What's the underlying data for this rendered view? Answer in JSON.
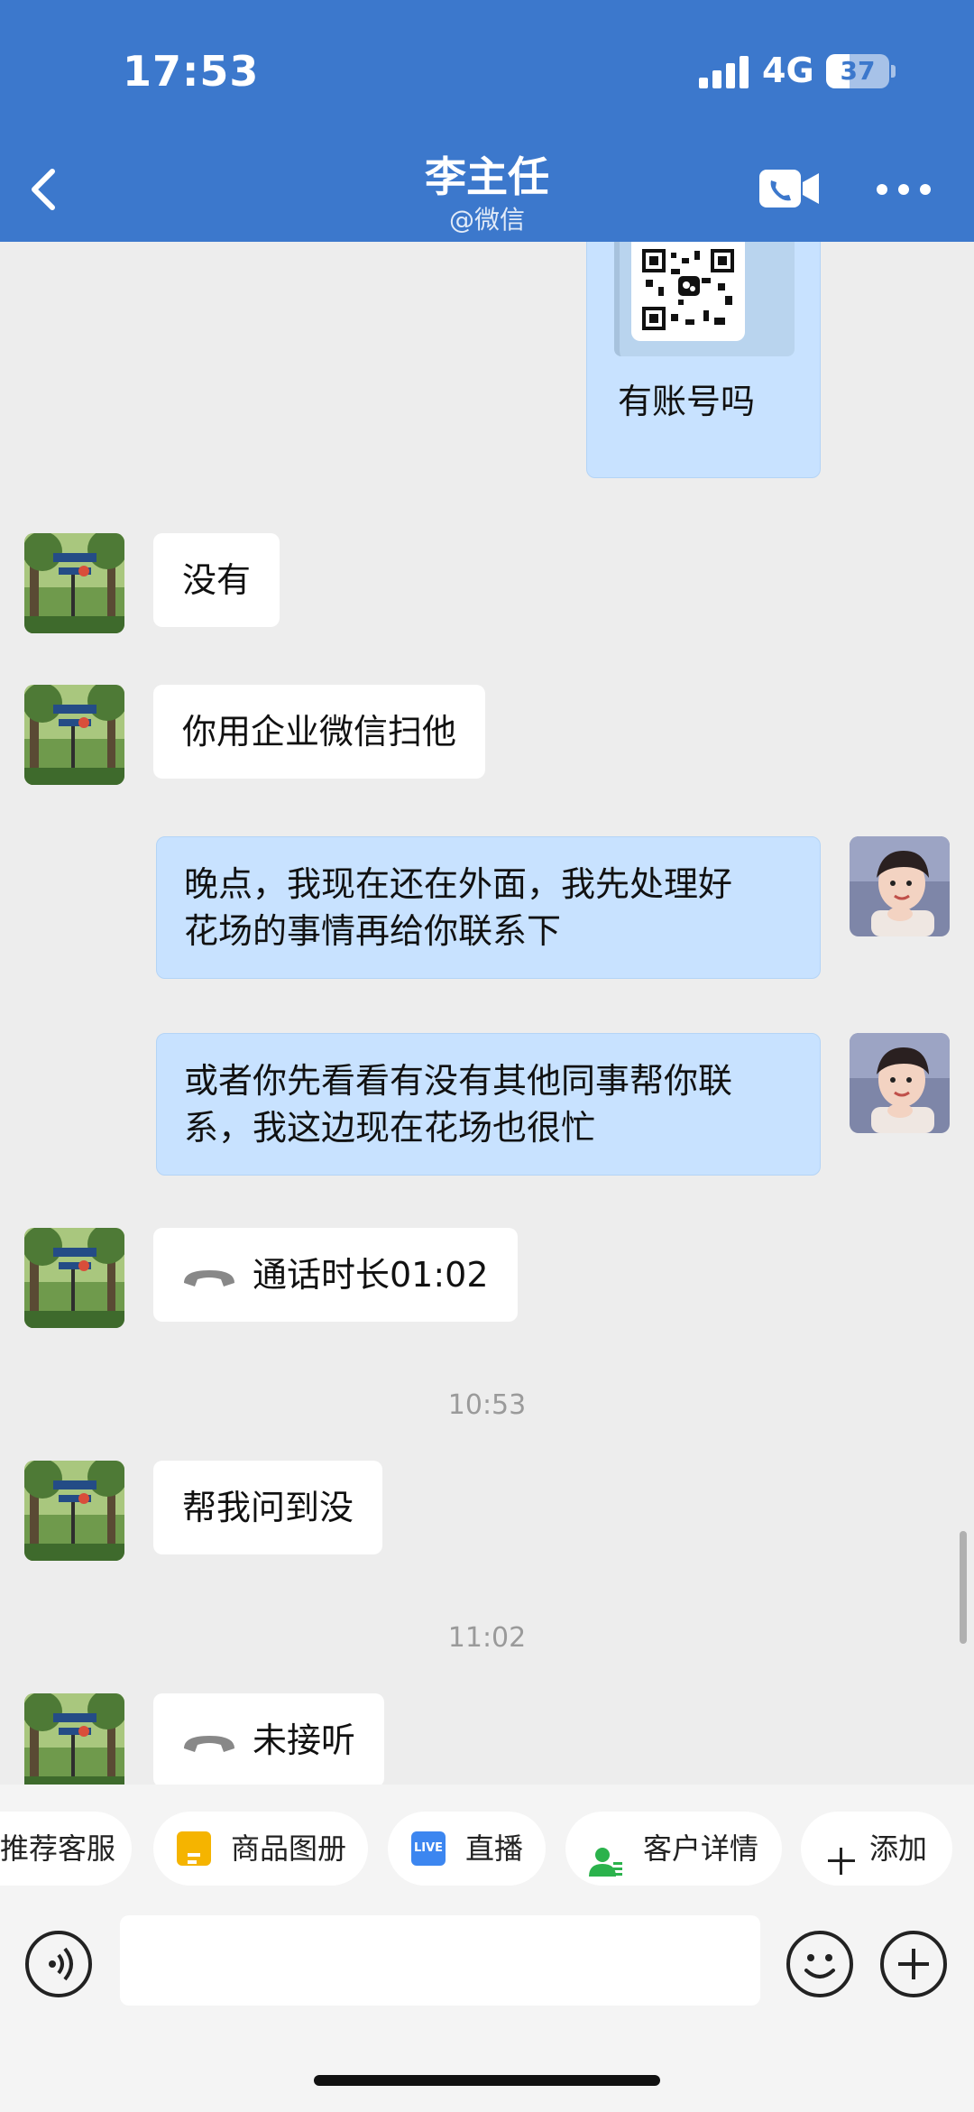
{
  "status_bar": {
    "time": "17:53",
    "network": "4G",
    "battery": "37",
    "battery_level": 0.37
  },
  "header": {
    "title": "李主任",
    "subtitle": "@微信"
  },
  "messages": {
    "qr_caption": "有账号吗",
    "m1": "没有",
    "m2": "你用企业微信扫他",
    "m3_line1": "晚点，我现在还在外面，我先处理好",
    "m3_line2": "花场的事情再给你联系下",
    "m4_line1": "或者你先看看有没有其他同事帮你联",
    "m4_line2": "系，我这边现在花场也很忙",
    "call1": "通话时长01:02",
    "time1": "10:53",
    "m5": "帮我问到没",
    "time2": "11:02",
    "call2": "未接听"
  },
  "quick_actions": {
    "recommend": "推荐客服",
    "catalog": "商品图册",
    "live": "直播",
    "live_icon_text": "LIVE",
    "customer": "客户详情",
    "add": "添加"
  },
  "colors": {
    "header_bg": "#3C78CC",
    "bubble_self": "#C8E2FF",
    "bubble_other": "#FFFFFF",
    "chat_bg": "#EDEDED",
    "catalog_icon": "#F5B400",
    "live_icon": "#3C86F0",
    "customer_icon": "#2BB24C"
  },
  "icons": {
    "back": "chevron-left-icon",
    "video_call": "video-call-icon",
    "more": "more-dots-icon",
    "voice": "voice-icon",
    "emoji": "emoji-icon",
    "plus": "plus-icon",
    "phone": "phone-handset-icon"
  }
}
